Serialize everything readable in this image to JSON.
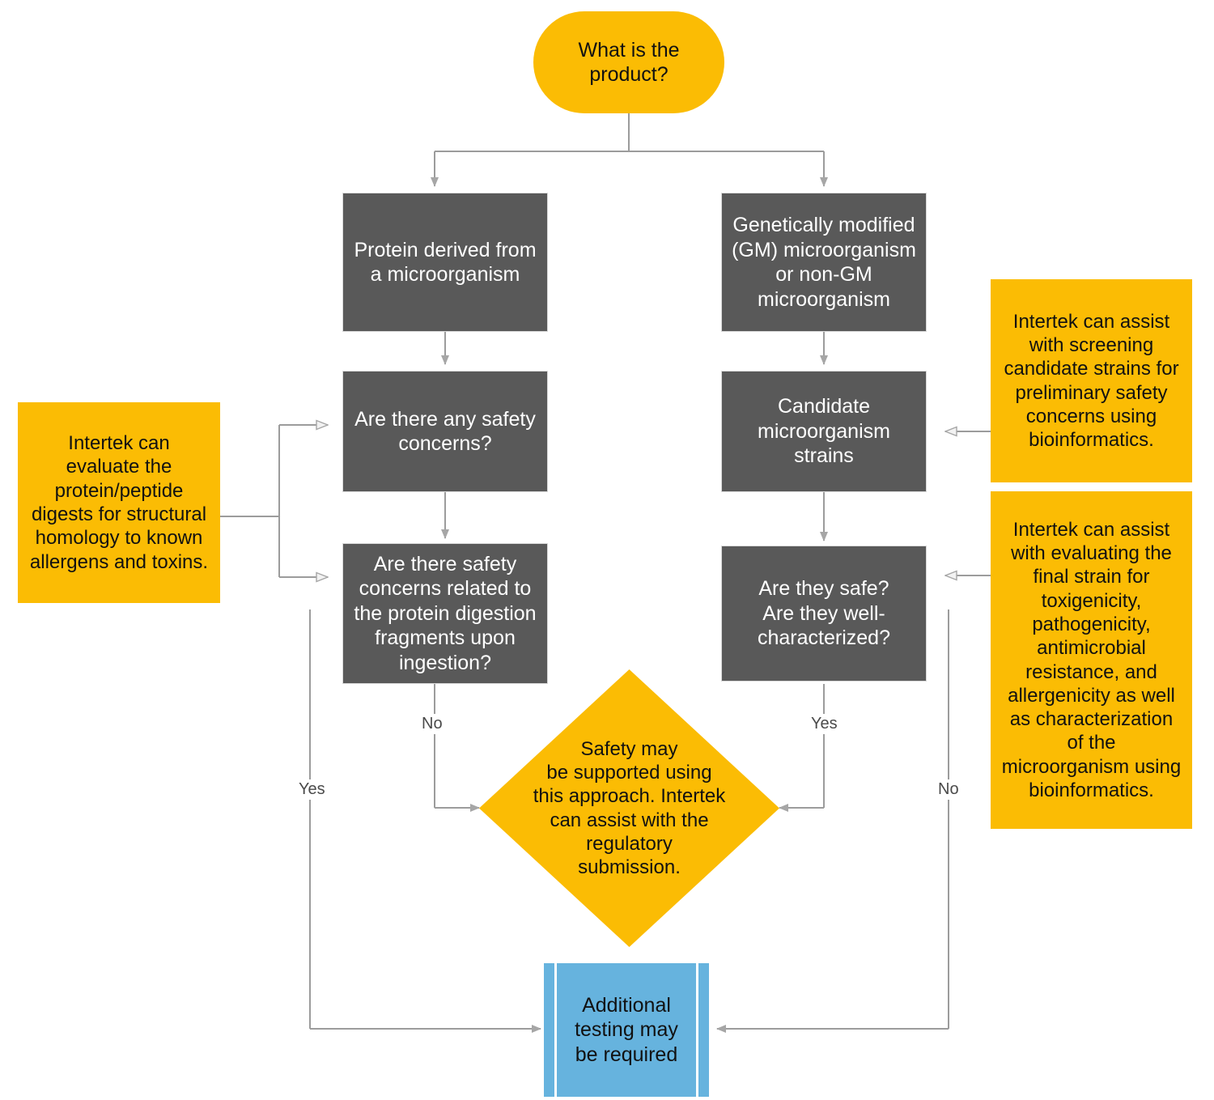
{
  "diagram": {
    "title": "Safety assessment decision flowchart for microbial products",
    "colors": {
      "accent_orange": "#FBBC04",
      "process_gray": "#595959",
      "predefined_blue": "#66B3DE",
      "connector_gray": "#9c9c9c",
      "arrow_fill_gray": "#a6a6a6",
      "text_dark": "#111111",
      "text_light": "#ffffff"
    },
    "nodes": {
      "start": {
        "shape": "terminator",
        "label": "What is the\nproduct?"
      },
      "protein_branch": {
        "shape": "process",
        "label": "Protein derived from\na microorganism"
      },
      "gm_branch": {
        "shape": "process",
        "label": "Genetically modified\n(GM) microorganism\nor non-GM\nmicroorganism"
      },
      "safety_concerns": {
        "shape": "process",
        "label": "Are there any safety\nconcerns?"
      },
      "digestion_fragments": {
        "shape": "process",
        "label": "Are there safety\nconcerns related to\nthe protein digestion\nfragments upon\ningestion?"
      },
      "candidate_strains": {
        "shape": "process",
        "label": "Candidate\nmicroorganism\nstrains"
      },
      "safe_characterized": {
        "shape": "process",
        "label": "Are they safe?\nAre they well-\ncharacterized?"
      },
      "note_protein": {
        "shape": "note",
        "label": "Intertek can\nevaluate the\nprotein/peptide\ndigests for structural\nhomology to known\nallergens and toxins."
      },
      "note_screening": {
        "shape": "note",
        "label": "Intertek can assist\nwith screening\ncandidate strains for\npreliminary safety\nconcerns using\nbioinformatics."
      },
      "note_final_strain": {
        "shape": "note",
        "label": "Intertek can assist\nwith evaluating the\nfinal strain for\ntoxigenicity,\npathogenicity,\nantimicrobial\nresistance, and\nallergenicity as well\nas characterization\nof the\nmicroorganism using\nbioinformatics."
      },
      "safety_supported": {
        "shape": "diamond",
        "label": "Safety may\nbe supported using\nthis approach. Intertek\ncan assist with the\nregulatory\nsubmission."
      },
      "additional_testing": {
        "shape": "predefined-process",
        "label": "Additional\ntesting may\nbe required"
      }
    },
    "edge_labels": {
      "digestion_yes": "Yes",
      "digestion_no": "No",
      "characterized_yes": "Yes",
      "characterized_no": "No"
    }
  }
}
